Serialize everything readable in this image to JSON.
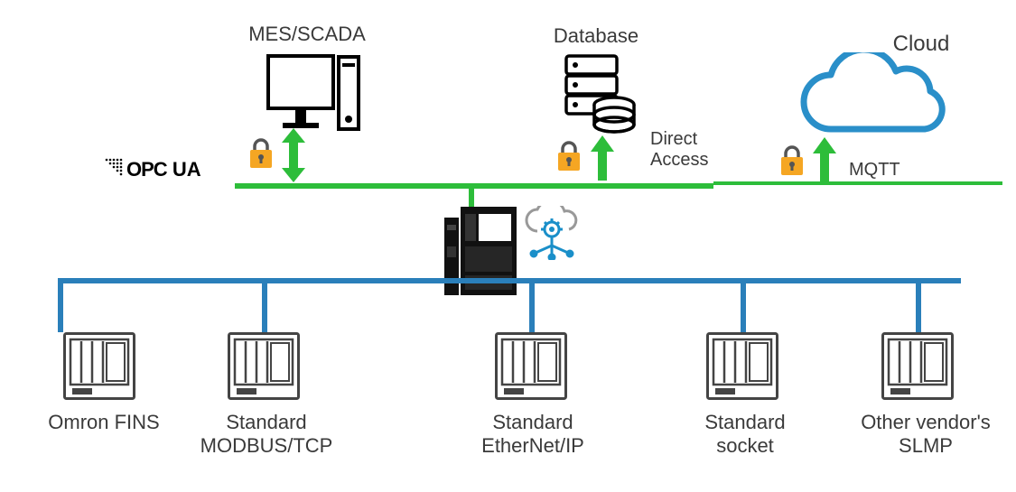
{
  "top": {
    "mes_scada": "MES/SCADA",
    "database": "Database",
    "cloud": "Cloud",
    "opcua": "OPC UA",
    "direct_access": "Direct\nAccess",
    "mqtt": "MQTT"
  },
  "bottom": {
    "omron_fins": "Omron FINS",
    "modbus": "Standard\nMODBUS/TCP",
    "ethernet_ip": "Standard\nEtherNet/IP",
    "socket": "Standard\nsocket",
    "slmp": "Other vendor's\nSLMP"
  }
}
